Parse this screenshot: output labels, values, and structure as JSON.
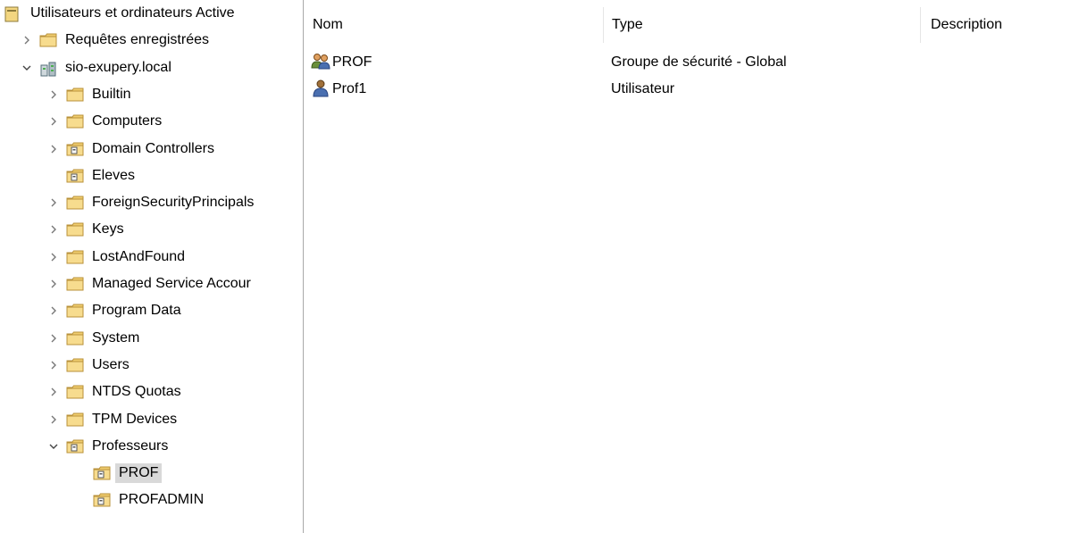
{
  "tree": {
    "root_label": "Utilisateurs et ordinateurs Active",
    "items": [
      {
        "label": "Requêtes enregistrées",
        "indent": 1,
        "expander": "collapsed",
        "icon": "folder-icon"
      },
      {
        "label": "sio-exupery.local",
        "indent": 1,
        "expander": "expanded",
        "icon": "domain-icon"
      },
      {
        "label": "Builtin",
        "indent": 2,
        "expander": "collapsed",
        "icon": "folder-icon"
      },
      {
        "label": "Computers",
        "indent": 2,
        "expander": "collapsed",
        "icon": "folder-icon"
      },
      {
        "label": "Domain Controllers",
        "indent": 2,
        "expander": "collapsed",
        "icon": "ou-icon"
      },
      {
        "label": "Eleves",
        "indent": 2,
        "expander": "none",
        "icon": "ou-icon"
      },
      {
        "label": "ForeignSecurityPrincipals",
        "indent": 2,
        "expander": "collapsed",
        "icon": "folder-icon"
      },
      {
        "label": "Keys",
        "indent": 2,
        "expander": "collapsed",
        "icon": "folder-icon"
      },
      {
        "label": "LostAndFound",
        "indent": 2,
        "expander": "collapsed",
        "icon": "folder-icon"
      },
      {
        "label": "Managed Service Accour",
        "indent": 2,
        "expander": "collapsed",
        "icon": "folder-icon"
      },
      {
        "label": "Program Data",
        "indent": 2,
        "expander": "collapsed",
        "icon": "folder-icon"
      },
      {
        "label": "System",
        "indent": 2,
        "expander": "collapsed",
        "icon": "folder-icon"
      },
      {
        "label": "Users",
        "indent": 2,
        "expander": "collapsed",
        "icon": "folder-icon"
      },
      {
        "label": "NTDS Quotas",
        "indent": 2,
        "expander": "collapsed",
        "icon": "folder-icon"
      },
      {
        "label": "TPM Devices",
        "indent": 2,
        "expander": "collapsed",
        "icon": "folder-icon"
      },
      {
        "label": "Professeurs",
        "indent": 2,
        "expander": "expanded",
        "icon": "ou-icon"
      },
      {
        "label": "PROF",
        "indent": 3,
        "expander": "none",
        "icon": "ou-icon",
        "selected": true
      },
      {
        "label": "PROFADMIN",
        "indent": 3,
        "expander": "none",
        "icon": "ou-icon"
      }
    ]
  },
  "list": {
    "columns": {
      "name": "Nom",
      "type": "Type",
      "description": "Description"
    },
    "rows": [
      {
        "name": "PROF",
        "type": "Groupe de sécurité - Global",
        "icon": "group-icon"
      },
      {
        "name": "Prof1",
        "type": "Utilisateur",
        "icon": "user-icon"
      }
    ]
  },
  "colors": {
    "folder": "#e8c25a",
    "selection": "#d9d9d9",
    "separator": "#a9a9a9"
  }
}
